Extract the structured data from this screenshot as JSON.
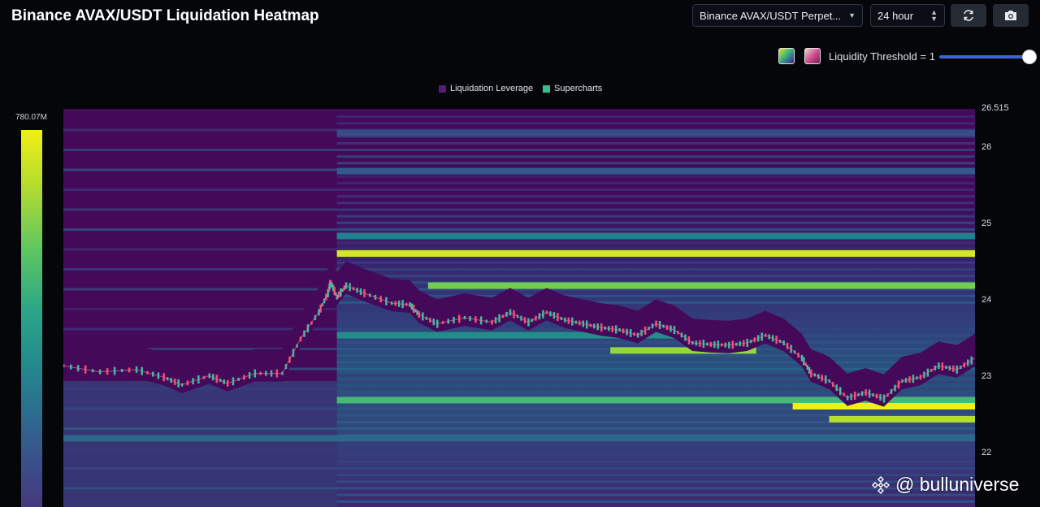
{
  "header": {
    "title": "Binance AVAX/USDT Liquidation Heatmap",
    "exchange_select": "Binance AVAX/USDT Perpet...",
    "interval_select": "24 hour",
    "refresh_icon": "refresh-icon",
    "camera_icon": "camera-icon"
  },
  "controls": {
    "threshold_label": "Liquidity Threshold = 1",
    "threshold_value": 1,
    "palette_viridis_color": "#4ec26a",
    "palette_pink_color": "#d1508f",
    "slider_color": "#3e63d8"
  },
  "legend": {
    "items": [
      {
        "label": "Liquidation Leverage",
        "color": "#5a1a78"
      },
      {
        "label": "Supercharts",
        "color": "#2fc08d"
      }
    ]
  },
  "colorbar": {
    "max_label": "780.07M"
  },
  "watermark": {
    "text": "@ bulluniverse"
  },
  "chart_data": {
    "type": "heatmap",
    "title": "Binance AVAX/USDT Liquidation Heatmap",
    "ylim": [
      21.3,
      26.515
    ],
    "y_ticks": [
      {
        "label": "26.515",
        "value": 26.515
      },
      {
        "label": "26",
        "value": 26
      },
      {
        "label": "25",
        "value": 25
      },
      {
        "label": "24",
        "value": 24
      },
      {
        "label": "23",
        "value": 23
      },
      {
        "label": "22",
        "value": 22
      }
    ],
    "colorbar_max": "780.07M",
    "liquidation_bands": [
      {
        "price": 24.62,
        "start": 0.3,
        "end": 1.0,
        "intensity": 0.95
      },
      {
        "price": 24.2,
        "start": 0.4,
        "end": 1.0,
        "intensity": 0.8
      },
      {
        "price": 24.85,
        "start": 0.3,
        "end": 1.0,
        "intensity": 0.45
      },
      {
        "price": 23.35,
        "start": 0.6,
        "end": 0.76,
        "intensity": 0.85
      },
      {
        "price": 23.55,
        "start": 0.3,
        "end": 0.76,
        "intensity": 0.5
      },
      {
        "price": 22.7,
        "start": 0.3,
        "end": 1.0,
        "intensity": 0.7
      },
      {
        "price": 22.62,
        "start": 0.8,
        "end": 1.0,
        "intensity": 1.0
      },
      {
        "price": 22.45,
        "start": 0.84,
        "end": 1.0,
        "intensity": 0.9
      },
      {
        "price": 22.2,
        "start": 0.0,
        "end": 1.0,
        "intensity": 0.35
      },
      {
        "price": 25.7,
        "start": 0.3,
        "end": 1.0,
        "intensity": 0.3
      },
      {
        "price": 26.2,
        "start": 0.3,
        "end": 1.0,
        "intensity": 0.25
      }
    ],
    "price_path": [
      {
        "t": 0.0,
        "p": 23.15
      },
      {
        "t": 0.04,
        "p": 23.07
      },
      {
        "t": 0.08,
        "p": 23.1
      },
      {
        "t": 0.11,
        "p": 23.0
      },
      {
        "t": 0.13,
        "p": 22.9
      },
      {
        "t": 0.16,
        "p": 23.02
      },
      {
        "t": 0.18,
        "p": 22.92
      },
      {
        "t": 0.21,
        "p": 23.05
      },
      {
        "t": 0.24,
        "p": 23.05
      },
      {
        "t": 0.26,
        "p": 23.5
      },
      {
        "t": 0.28,
        "p": 23.85
      },
      {
        "t": 0.3,
        "p": 24.05
      },
      {
        "t": 0.29,
        "p": 24.1
      },
      {
        "t": 0.293,
        "p": 24.25
      },
      {
        "t": 0.31,
        "p": 24.2
      },
      {
        "t": 0.33,
        "p": 24.1
      },
      {
        "t": 0.36,
        "p": 23.97
      },
      {
        "t": 0.38,
        "p": 23.95
      },
      {
        "t": 0.39,
        "p": 23.82
      },
      {
        "t": 0.41,
        "p": 23.7
      },
      {
        "t": 0.44,
        "p": 23.78
      },
      {
        "t": 0.47,
        "p": 23.72
      },
      {
        "t": 0.49,
        "p": 23.85
      },
      {
        "t": 0.51,
        "p": 23.72
      },
      {
        "t": 0.53,
        "p": 23.85
      },
      {
        "t": 0.55,
        "p": 23.75
      },
      {
        "t": 0.57,
        "p": 23.7
      },
      {
        "t": 0.59,
        "p": 23.65
      },
      {
        "t": 0.61,
        "p": 23.62
      },
      {
        "t": 0.63,
        "p": 23.55
      },
      {
        "t": 0.65,
        "p": 23.7
      },
      {
        "t": 0.67,
        "p": 23.62
      },
      {
        "t": 0.69,
        "p": 23.45
      },
      {
        "t": 0.71,
        "p": 23.43
      },
      {
        "t": 0.73,
        "p": 23.42
      },
      {
        "t": 0.75,
        "p": 23.45
      },
      {
        "t": 0.77,
        "p": 23.55
      },
      {
        "t": 0.79,
        "p": 23.45
      },
      {
        "t": 0.81,
        "p": 23.25
      },
      {
        "t": 0.82,
        "p": 23.05
      },
      {
        "t": 0.84,
        "p": 22.95
      },
      {
        "t": 0.86,
        "p": 22.73
      },
      {
        "t": 0.88,
        "p": 22.8
      },
      {
        "t": 0.9,
        "p": 22.72
      },
      {
        "t": 0.92,
        "p": 22.95
      },
      {
        "t": 0.94,
        "p": 23.0
      },
      {
        "t": 0.96,
        "p": 23.15
      },
      {
        "t": 0.98,
        "p": 23.1
      },
      {
        "t": 1.0,
        "p": 23.25
      }
    ]
  }
}
